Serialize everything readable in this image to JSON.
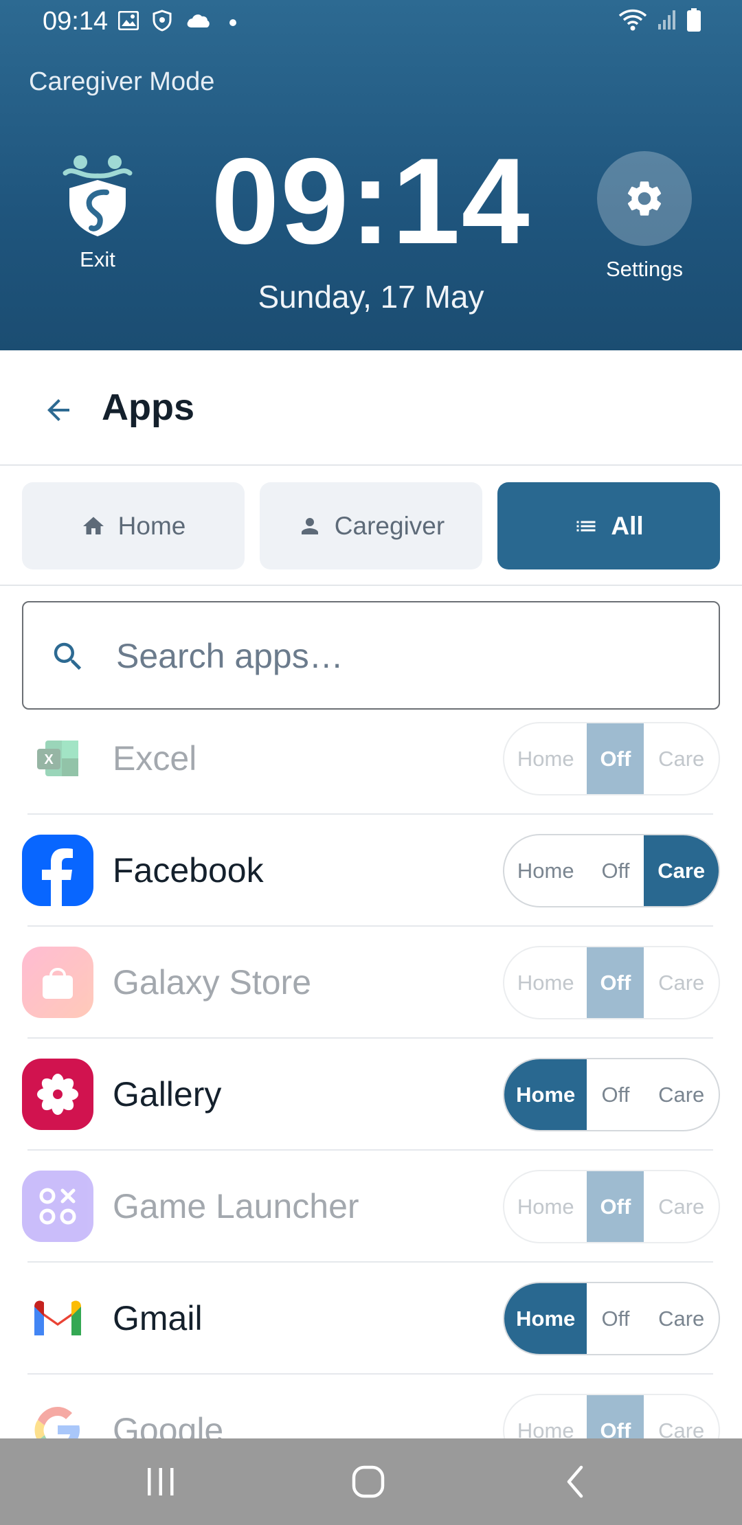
{
  "status_bar": {
    "time": "09:14",
    "left_icons": [
      "image-icon",
      "shield-icon",
      "cloud-icon",
      "dot-icon"
    ],
    "right_icons": [
      "wifi-icon",
      "signal-icon",
      "battery-icon"
    ]
  },
  "header": {
    "mode_title": "Caregiver Mode",
    "exit_label": "Exit",
    "clock": "09:14",
    "date": "Sunday, 17 May",
    "settings_label": "Settings"
  },
  "page": {
    "title": "Apps"
  },
  "tabs": [
    {
      "label": "Home",
      "icon": "home-icon",
      "active": false
    },
    {
      "label": "Caregiver",
      "icon": "person-icon",
      "active": false
    },
    {
      "label": "All",
      "icon": "list-icon",
      "active": true
    }
  ],
  "search": {
    "placeholder": "Search apps…",
    "value": ""
  },
  "segment_labels": {
    "home": "Home",
    "off": "Off",
    "care": "Care"
  },
  "apps": [
    {
      "name": "Excel",
      "mode": "Off",
      "icon": "excel-icon"
    },
    {
      "name": "Facebook",
      "mode": "Care",
      "icon": "facebook-icon"
    },
    {
      "name": "Galaxy Store",
      "mode": "Off",
      "icon": "galaxy-store-icon"
    },
    {
      "name": "Gallery",
      "mode": "Home",
      "icon": "gallery-icon"
    },
    {
      "name": "Game Launcher",
      "mode": "Off",
      "icon": "game-launcher-icon"
    },
    {
      "name": "Gmail",
      "mode": "Home",
      "icon": "gmail-icon"
    },
    {
      "name": "Google",
      "mode": "Off",
      "icon": "google-icon"
    }
  ],
  "colors": {
    "header_bg": "#2d6a92",
    "accent": "#296890",
    "off_selected_dim": "#9ebbd0"
  }
}
